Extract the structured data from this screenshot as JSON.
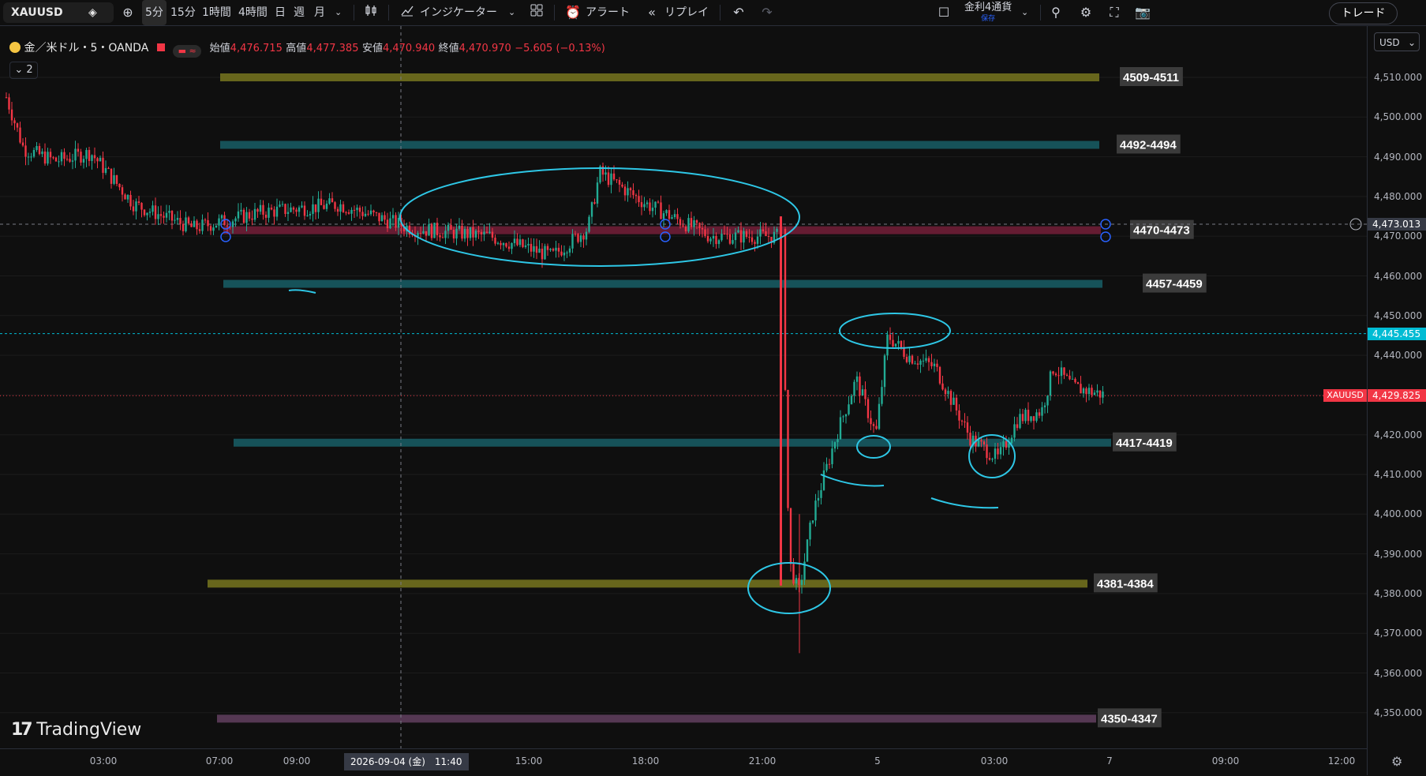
{
  "toolbar": {
    "symbol": "XAUUSD",
    "timeframes": [
      "5分",
      "15分",
      "1時間",
      "4時間",
      "日",
      "週",
      "月"
    ],
    "active_timeframe": "5分",
    "indicators_label": "インジケーター",
    "alert_label": "アラート",
    "replay_label": "リプレイ",
    "layout_name": "金利4通貨",
    "layout_status": "保存",
    "trade_label": "トレード"
  },
  "legend": {
    "title": "金／米ドル・5・OANDA",
    "open_label": "始値",
    "open": "4,476.715",
    "high_label": "高値",
    "high": "4,477.385",
    "low_label": "安値",
    "low": "4,470.940",
    "close_label": "終値",
    "close": "4,470.970",
    "change": "−5.605 (−0.13%)",
    "count": "2"
  },
  "price_axis": {
    "currency": "USD",
    "ticks": [
      4510,
      4500,
      4490,
      4480,
      4470,
      4460,
      4450,
      4440,
      4430,
      4420,
      4410,
      4400,
      4390,
      4380,
      4370,
      4360,
      4350
    ],
    "tick_labels": [
      "4,510.000",
      "4,500.000",
      "4,490.000",
      "4,480.000",
      "4,470.000",
      "4,460.000",
      "4,450.000",
      "4,440.000",
      "4,430.000",
      "4,420.000",
      "4,410.000",
      "4,400.000",
      "4,390.000",
      "4,380.000",
      "4,370.000",
      "4,360.000",
      "4,350.000"
    ],
    "crosshair_price": "4,473.013",
    "alert_price": "4,445.455",
    "last_symbol": "XAUUSD",
    "last_price": "4,429.825"
  },
  "time_axis": {
    "labels": [
      "03:00",
      "07:00",
      "09:00",
      "15:00",
      "18:00",
      "21:00",
      "5",
      "03:00",
      "7",
      "09:00",
      "12:00"
    ],
    "crosshair_time": "2026-09-04 (金)　11:40"
  },
  "levels": [
    {
      "label": "4509-4511",
      "price": 4510,
      "color": "#6d6c1d"
    },
    {
      "label": "4492-4494",
      "price": 4493,
      "color": "#17565e"
    },
    {
      "label": "4470-4473",
      "price": 4471.5,
      "color": "#6a1d35"
    },
    {
      "label": "4457-4459",
      "price": 4458,
      "color": "#17565e"
    },
    {
      "label": "4417-4419",
      "price": 4418,
      "color": "#17565e"
    },
    {
      "label": "4381-4384",
      "price": 4382.5,
      "color": "#6d6c1d"
    },
    {
      "label": "4350-4347",
      "price": 4348.5,
      "color": "#5a3b57"
    }
  ],
  "colors": {
    "up": "#22ab94",
    "down": "#f23645",
    "annotation": "#2ec7e6",
    "alert_line": "#00bcd4"
  },
  "chart_data": {
    "type": "candlestick",
    "title": "金／米ドル・5・OANDA",
    "ylim": [
      4345,
      4513
    ],
    "key_points": [
      {
        "t": "02:00",
        "price": 4505
      },
      {
        "t": "07:00",
        "price": 4476
      },
      {
        "t": "14:00",
        "price": 4472
      },
      {
        "t": "16:00",
        "price": 4488
      },
      {
        "t": "21:05",
        "price": 4475
      },
      {
        "t": "21:40",
        "price": 4376
      },
      {
        "t": "5日 01:00",
        "price": 4447
      },
      {
        "t": "5日 03:00",
        "price": 4414
      },
      {
        "t": "5日 07:00",
        "price": 4430
      }
    ]
  },
  "branding": {
    "logo_text": "TradingView"
  }
}
